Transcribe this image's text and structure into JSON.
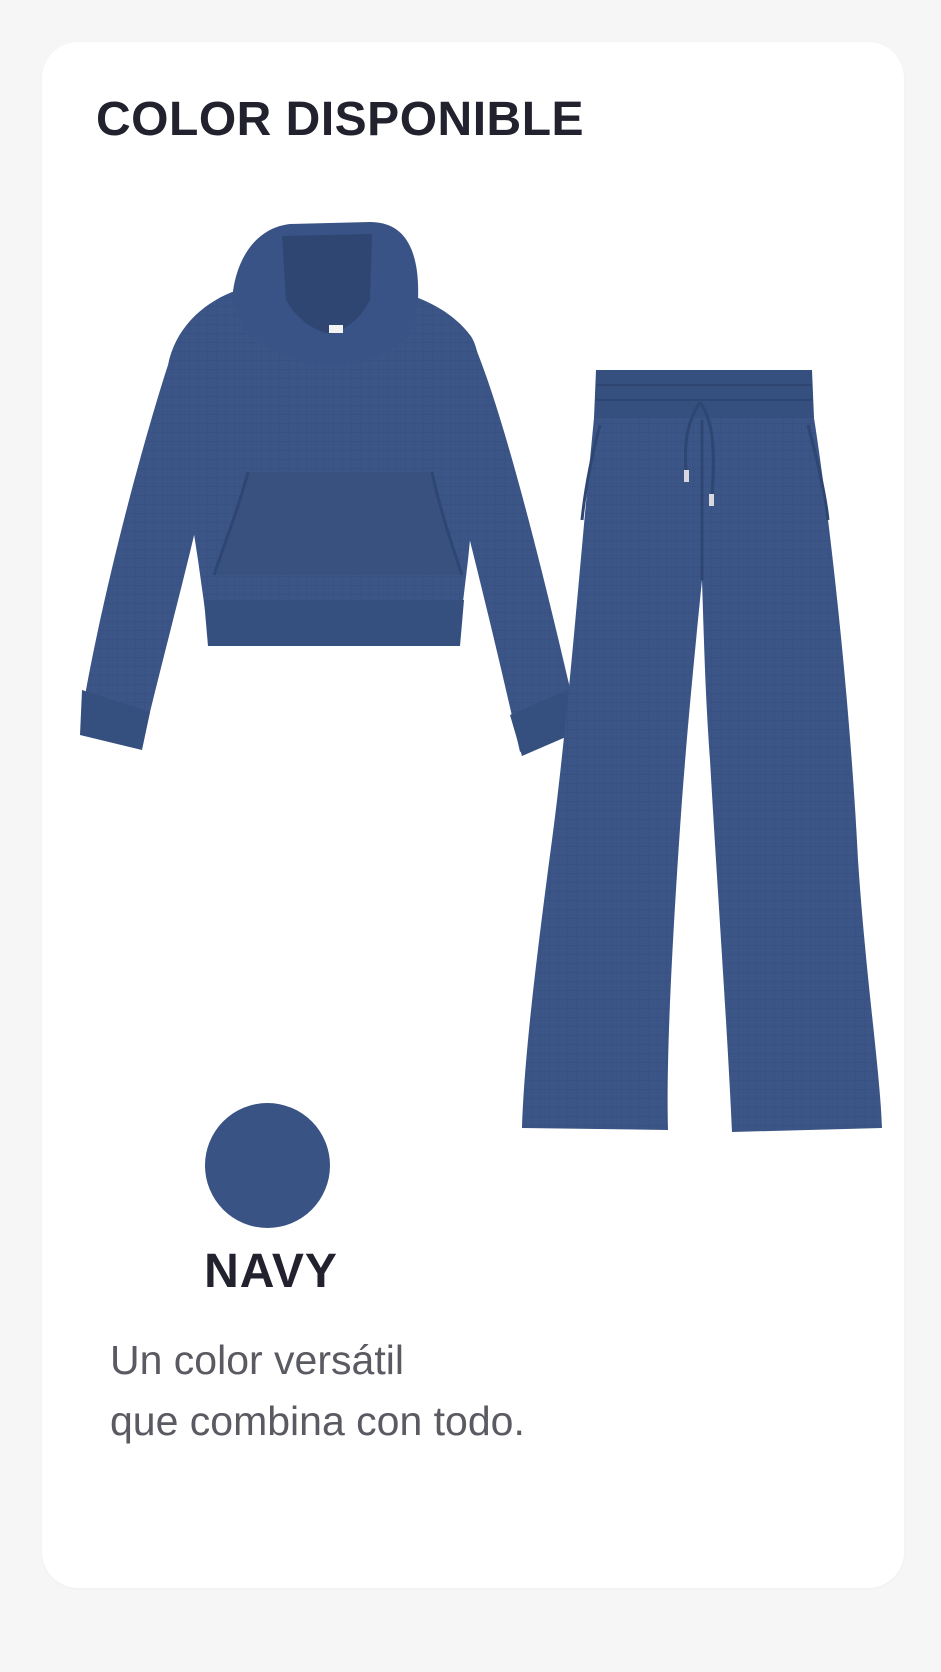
{
  "header": {
    "title": "COLOR DISPONIBLE"
  },
  "product": {
    "items": [
      "hoodie-icon",
      "pants-icon"
    ],
    "garment_color": "#3b5587",
    "garment_shadow": "#2f4673"
  },
  "swatch": {
    "name": "NAVY",
    "color": "#3a5385"
  },
  "description": {
    "line1": "Un color versátil",
    "line2": "que combina con todo."
  }
}
